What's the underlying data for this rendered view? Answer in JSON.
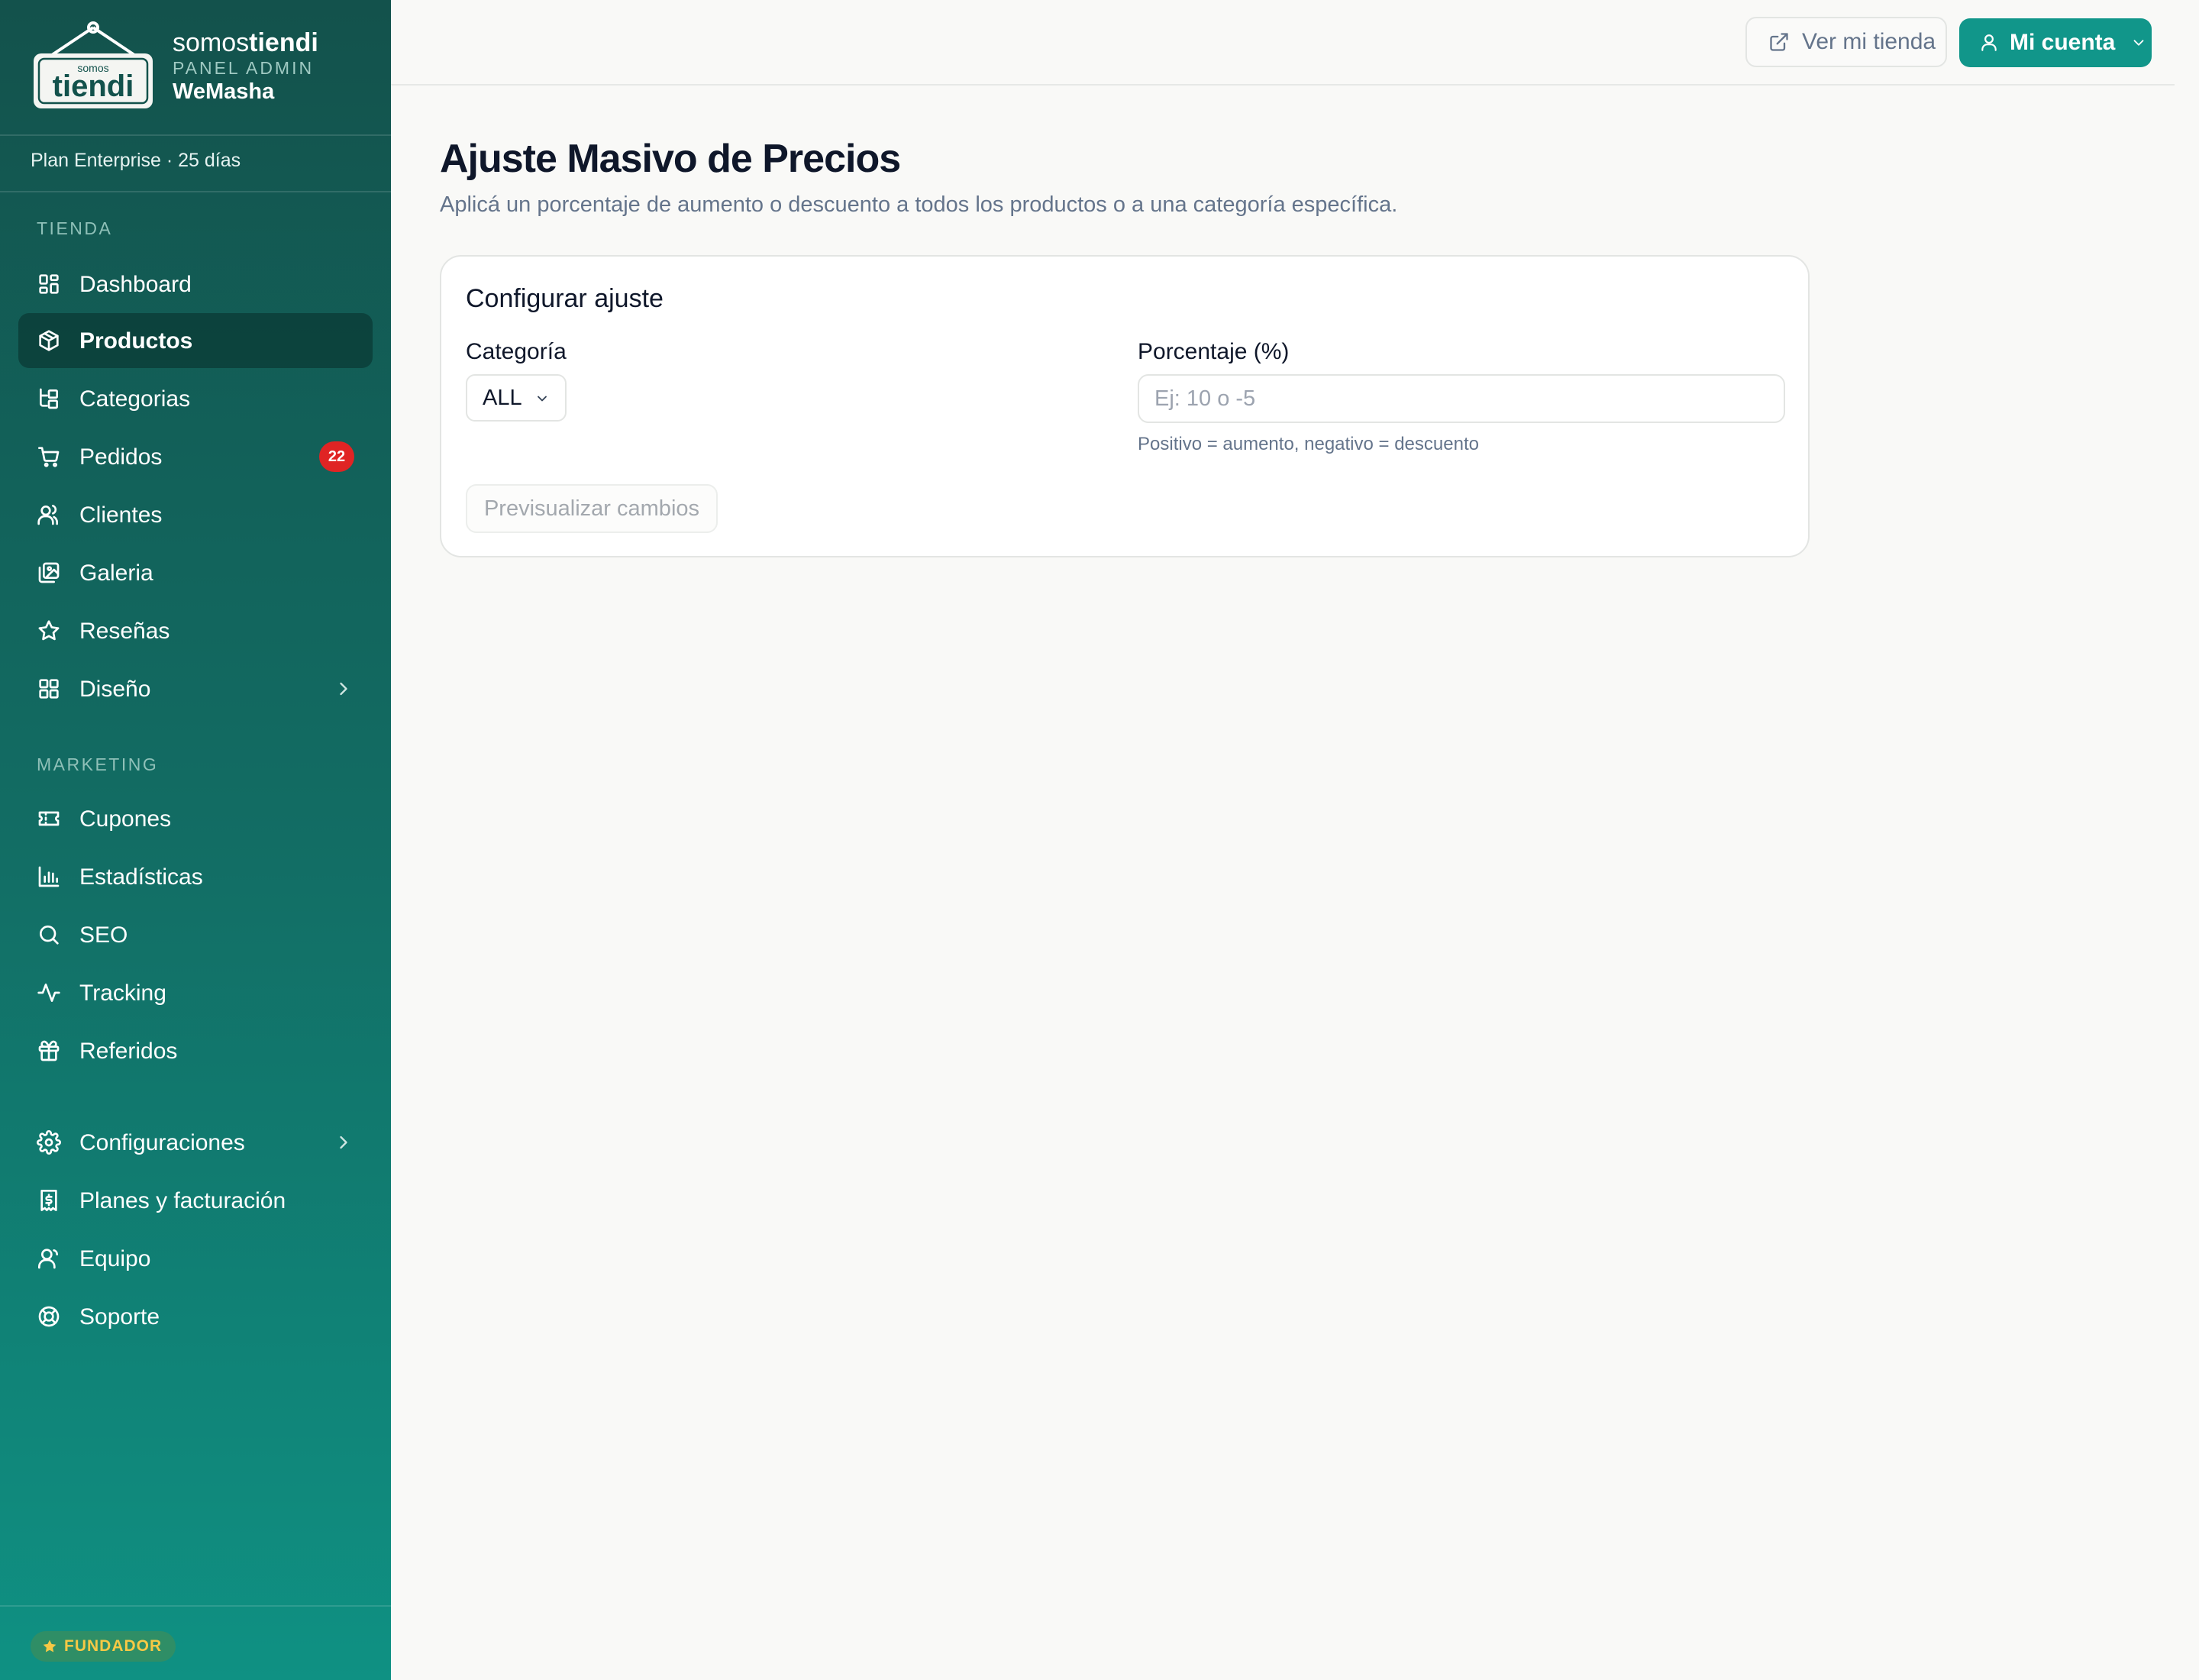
{
  "brand": {
    "logo_small": "somos",
    "logo_big": "tiendi",
    "name_light": "somos",
    "name_bold": "tiendi",
    "panel": "PANEL ADMIN",
    "store": "WeMasha"
  },
  "plan": "Plan Enterprise · 25 días",
  "sidebar": {
    "section_tienda": "TIENDA",
    "section_marketing": "MARKETING",
    "tienda_items": [
      {
        "label": "Dashboard",
        "icon": "grid-icon"
      },
      {
        "label": "Productos",
        "icon": "package-icon",
        "active": true
      },
      {
        "label": "Categorias",
        "icon": "tree-icon"
      },
      {
        "label": "Pedidos",
        "icon": "cart-icon",
        "badge": "22"
      },
      {
        "label": "Clientes",
        "icon": "users-icon"
      },
      {
        "label": "Galeria",
        "icon": "images-icon"
      },
      {
        "label": "Reseñas",
        "icon": "star-icon"
      },
      {
        "label": "Diseño",
        "icon": "layout-icon"
      }
    ],
    "marketing_items": [
      {
        "label": "Cupones",
        "icon": "ticket-icon"
      },
      {
        "label": "Estadísticas",
        "icon": "bar-chart-icon"
      },
      {
        "label": "SEO",
        "icon": "search-icon"
      },
      {
        "label": "Tracking",
        "icon": "activity-icon"
      },
      {
        "label": "Referidos",
        "icon": "gift-icon"
      }
    ],
    "settings_items": [
      {
        "label": "Configuraciones",
        "icon": "gear-icon"
      },
      {
        "label": "Planes y facturación",
        "icon": "receipt-icon"
      },
      {
        "label": "Equipo",
        "icon": "user-group-icon"
      },
      {
        "label": "Soporte",
        "icon": "lifebuoy-icon"
      }
    ],
    "founder_badge": "FUNDADOR"
  },
  "topbar": {
    "view_store": "Ver mi tienda",
    "account": "Mi cuenta"
  },
  "main": {
    "title": "Ajuste Masivo de Precios",
    "subtitle": "Aplicá un porcentaje de aumento o descuento a todos los productos o a una categoría específica.",
    "card": {
      "title": "Configurar ajuste",
      "category_label": "Categoría",
      "category_value": "ALL",
      "percent_label": "Porcentaje (%)",
      "percent_placeholder": "Ej: 10 o -5",
      "percent_value": "",
      "hint": "Positivo = aumento, negativo = descuento",
      "preview_button": "Previsualizar cambios"
    }
  },
  "colors": {
    "accent": "#11968a",
    "sidebar_top": "#13524c",
    "sidebar_bottom": "#0f9183",
    "badge": "#e02424",
    "founder": "#f6c945"
  }
}
